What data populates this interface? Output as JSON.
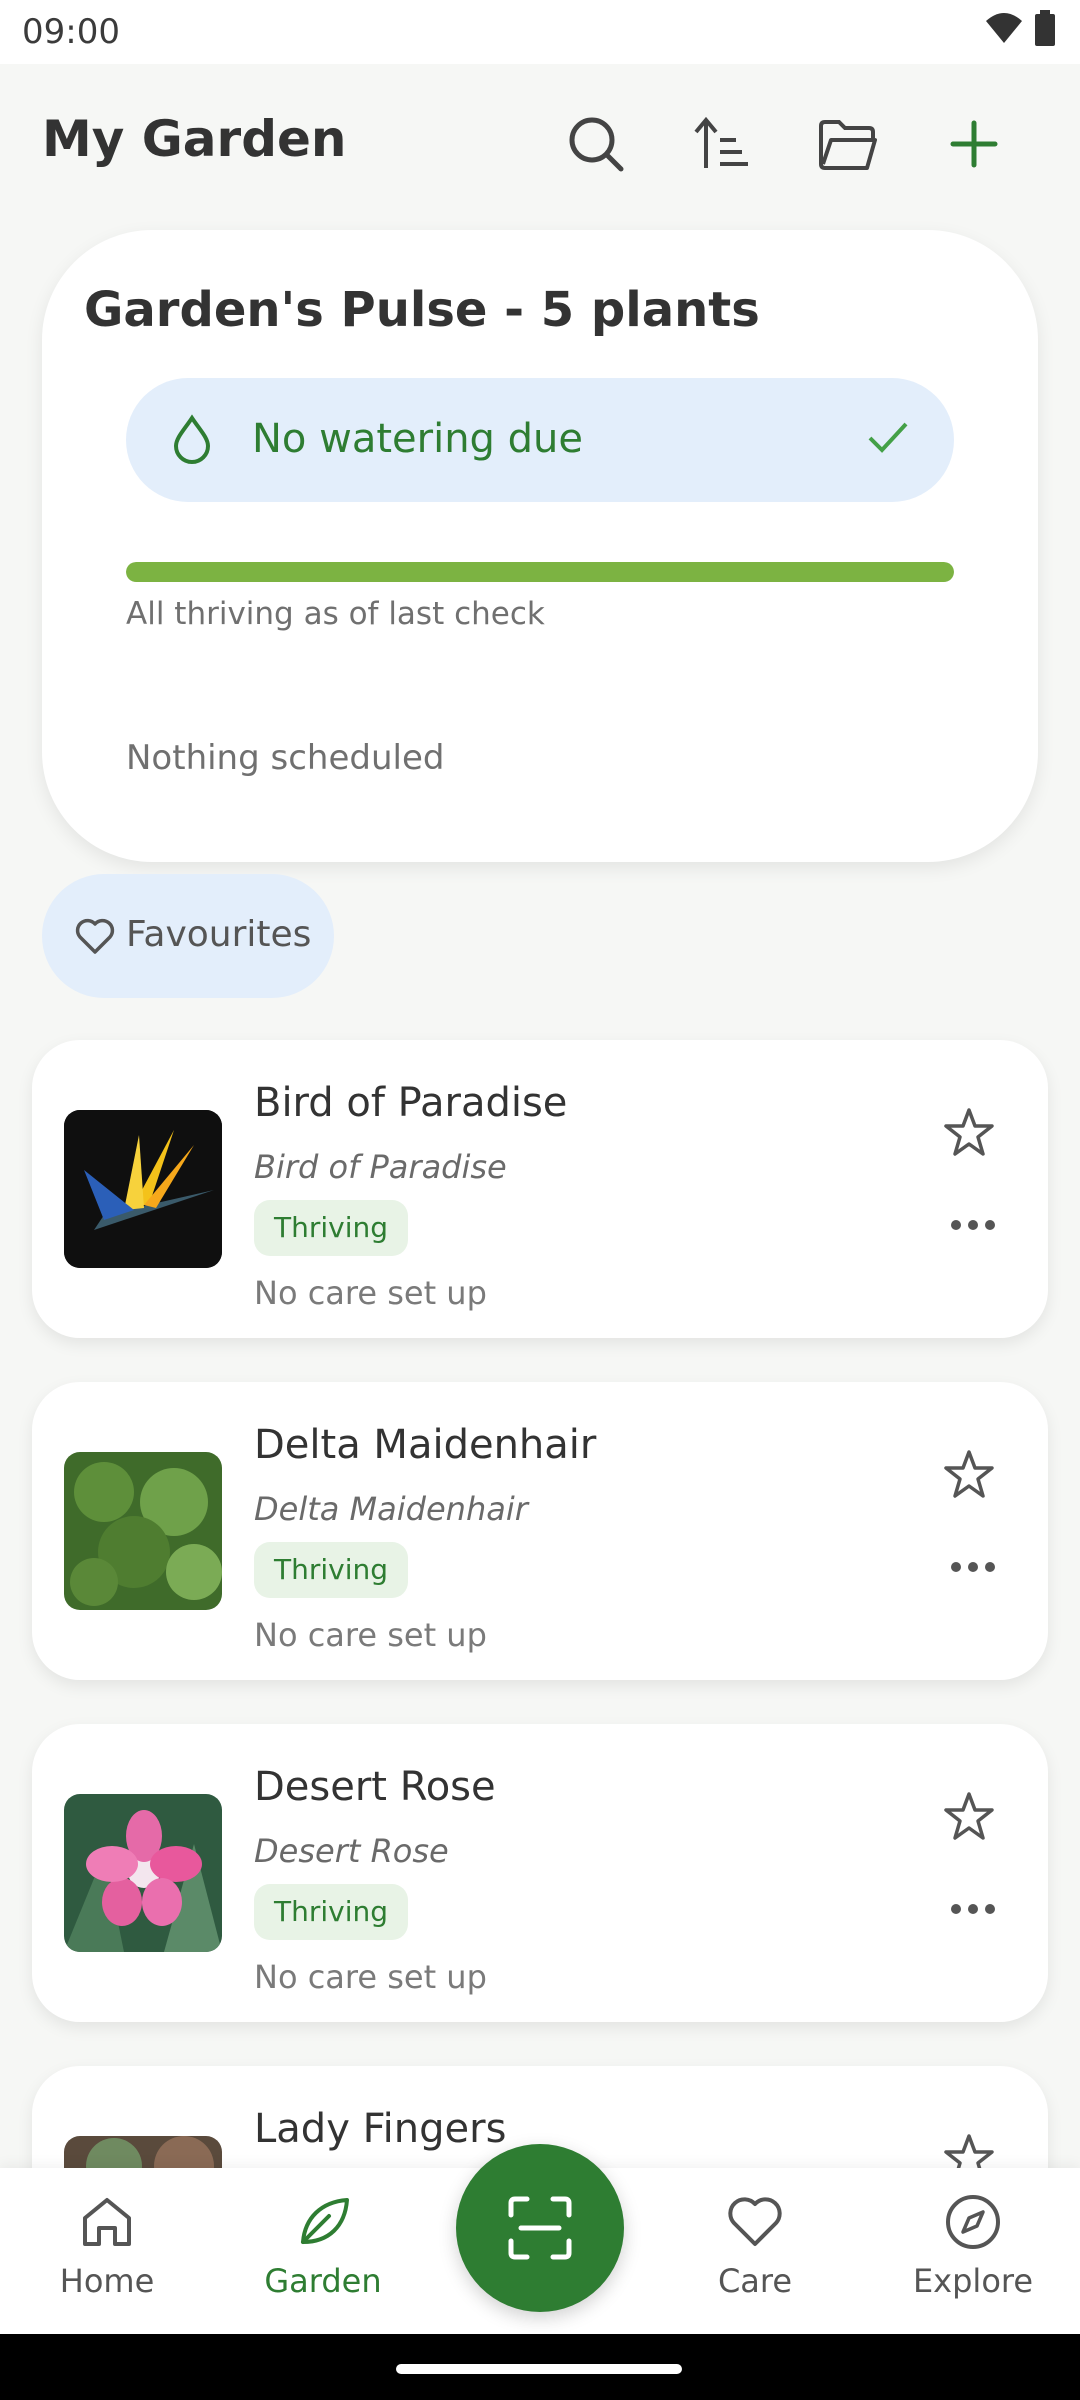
{
  "status_bar": {
    "time": "09:00"
  },
  "header": {
    "title": "My Garden"
  },
  "pulse": {
    "title": "Garden's Pulse - 5 plants",
    "watering_text": "No watering due",
    "progress_fraction": 1.0,
    "status_text": "All thriving as of last check",
    "schedule_text": "Nothing scheduled"
  },
  "filter": {
    "favourites_label": "Favourites"
  },
  "plants": [
    {
      "name": "Bird of Paradise",
      "species": "Bird of Paradise",
      "status": "Thriving",
      "care": "No care set up"
    },
    {
      "name": "Delta Maidenhair",
      "species": "Delta Maidenhair",
      "status": "Thriving",
      "care": "No care set up"
    },
    {
      "name": "Desert Rose",
      "species": "Desert Rose",
      "status": "Thriving",
      "care": "No care set up"
    },
    {
      "name": "Lady Fingers",
      "species": "",
      "status": "",
      "care": ""
    }
  ],
  "nav": {
    "home": "Home",
    "garden": "Garden",
    "care": "Care",
    "explore": "Explore"
  },
  "colors": {
    "accent": "#2e7d32",
    "progress": "#7cb342",
    "pill_bg": "#e3eefb"
  }
}
